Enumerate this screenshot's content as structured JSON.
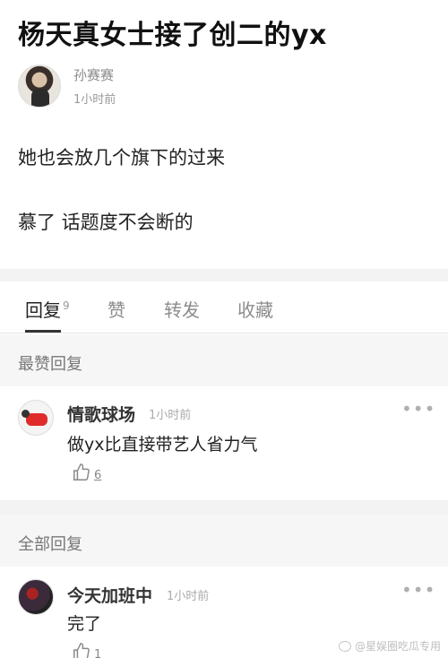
{
  "post": {
    "title": "杨天真女士接了创二的yx",
    "author_name": "孙赛赛",
    "time": "1小时前",
    "lines": [
      "她也会放几个旗下的过来",
      "慕了 话题度不会断的"
    ]
  },
  "tabs": [
    {
      "label": "回复",
      "badge": "9",
      "active": true
    },
    {
      "label": "赞"
    },
    {
      "label": "转发"
    },
    {
      "label": "收藏"
    }
  ],
  "sections": {
    "top": "最赞回复",
    "all": "全部回复"
  },
  "comments": [
    {
      "name": "情歌球场",
      "time": "1小时前",
      "text": "做yx比直接带艺人省力气",
      "likes": "6"
    },
    {
      "name": "今天加班中",
      "time": "1小时前",
      "text": "完了",
      "likes": "1"
    }
  ],
  "more_label": "•••",
  "watermark": "@星娱圈吃瓜专用",
  "icons": {
    "like": "thumbs-up-icon",
    "more": "more-dots-icon"
  }
}
